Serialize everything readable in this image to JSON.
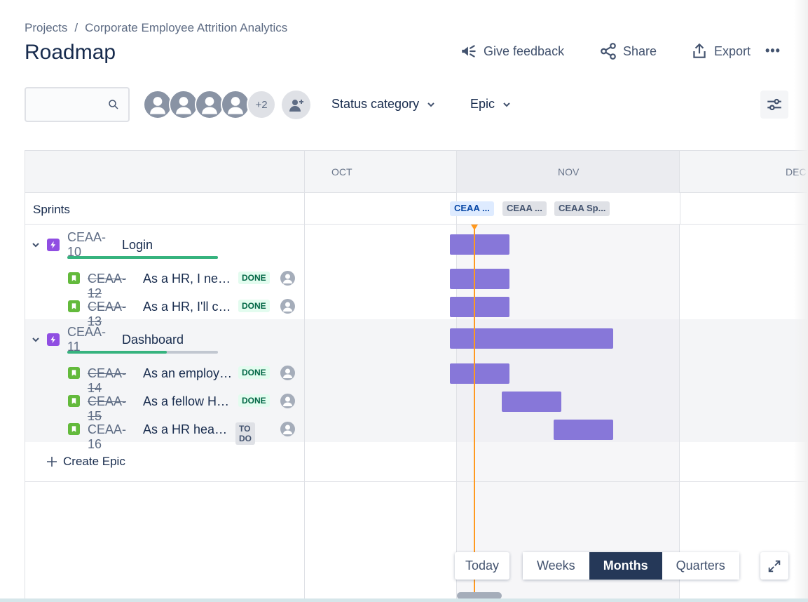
{
  "breadcrumb": {
    "projects": "Projects",
    "separator": "/",
    "project_name": "Corporate Employee Attrition Analytics"
  },
  "page_title": "Roadmap",
  "actions": {
    "feedback": "Give feedback",
    "share": "Share",
    "export": "Export",
    "more": "•••"
  },
  "search": {
    "placeholder": ""
  },
  "people": {
    "more_count": "+2"
  },
  "filters": {
    "status": "Status category",
    "epic": "Epic"
  },
  "timeline": {
    "months": [
      "OCT",
      "NOV",
      "DEC"
    ],
    "sprints_label": "Sprints",
    "sprints": [
      "CEAA ...",
      "CEAA ...",
      "CEAA Sp..."
    ]
  },
  "epics": [
    {
      "key": "CEAA-10",
      "name": "Login",
      "progress": 1.0,
      "issues": [
        {
          "key": "CEAA-12",
          "summary": "As a HR, I need...",
          "status": "DONE"
        },
        {
          "key": "CEAA-13",
          "summary": "As a HR, I'll co...",
          "status": "DONE"
        }
      ]
    },
    {
      "key": "CEAA-11",
      "name": "Dashboard",
      "progress": 0.66,
      "issues": [
        {
          "key": "CEAA-14",
          "summary": "As an employe...",
          "status": "DONE"
        },
        {
          "key": "CEAA-15",
          "summary": "As a fellow HR,...",
          "status": "DONE"
        },
        {
          "key": "CEAA-16",
          "summary": "As a HR head, ...",
          "status": "TO DO"
        }
      ]
    }
  ],
  "create_epic": "Create Epic",
  "view": {
    "today": "Today",
    "weeks": "Weeks",
    "months": "Months",
    "quarters": "Quarters",
    "selected": "Months"
  },
  "colors": {
    "bar": "#8777D9",
    "today": "#FF991F",
    "epic": "#904EE2",
    "story": "#63BA3C",
    "active_view": "#253858"
  }
}
